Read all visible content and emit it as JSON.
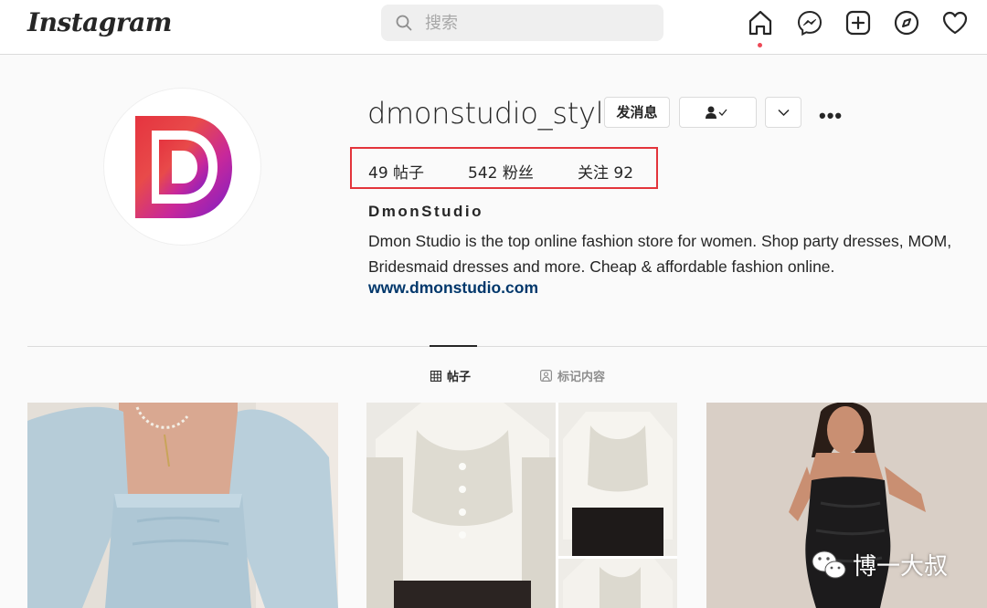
{
  "header": {
    "logo": "Instagram",
    "search_placeholder": "搜索"
  },
  "profile": {
    "username": "dmonstudio_style",
    "message_button": "发消息",
    "posts_stat": "49 帖子",
    "followers_stat": "542 粉丝",
    "following_stat": "关注 92",
    "full_name": "DmonStudio",
    "bio_line1": "Dmon Studio is the top online fashion store for women. Shop party dresses, MOM,",
    "bio_line2": "Bridesmaid dresses and more. Cheap & affordable fashion online.",
    "website": "www.dmonstudio.com"
  },
  "tabs": [
    {
      "label": "帖子",
      "icon": "grid-icon",
      "active": true
    },
    {
      "label": "标记内容",
      "icon": "tag-person-icon",
      "active": false
    }
  ],
  "watermark": "博一大叔",
  "colors": {
    "highlight_box": "#e3343b",
    "link": "#00376b",
    "notification_dot": "#ed4956"
  }
}
